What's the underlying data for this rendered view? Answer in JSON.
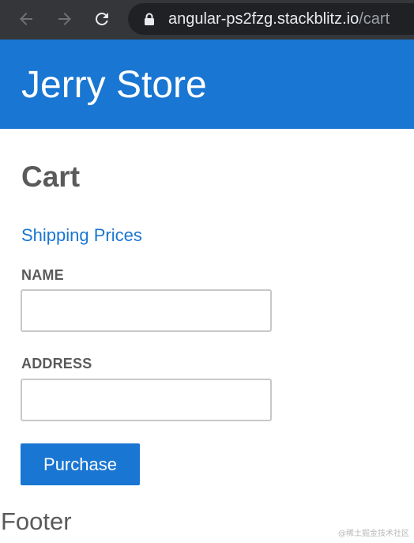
{
  "browser": {
    "url_host": "angular-ps2fzg.stackblitz.io",
    "url_path": "/cart",
    "icons": {
      "back": "arrow-left-icon",
      "forward": "arrow-right-icon",
      "reload": "reload-icon",
      "lock": "lock-icon"
    }
  },
  "header": {
    "title": "Jerry Store"
  },
  "cart": {
    "title": "Cart",
    "shipping_link": "Shipping Prices",
    "name_label": "NAME",
    "name_value": "",
    "address_label": "ADDRESS",
    "address_value": "",
    "purchase_label": "Purchase"
  },
  "footer": {
    "text": "Footer"
  },
  "watermark": {
    "text": "@稀土掘金技术社区"
  },
  "colors": {
    "primary": "#1976d2",
    "browser_chrome": "#35363a",
    "url_bar": "#202124",
    "text_dark": "#5a5a5a"
  }
}
